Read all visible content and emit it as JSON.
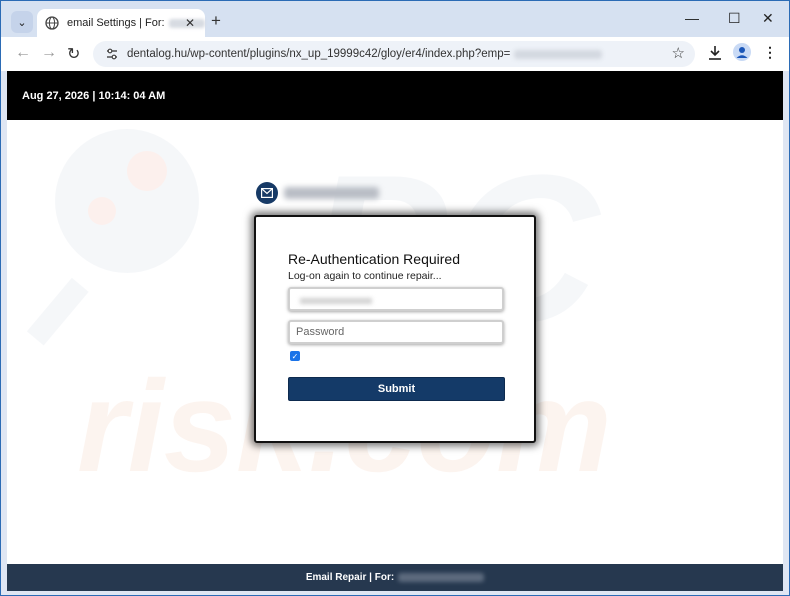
{
  "browser": {
    "tab_title": "email Settings | For:",
    "url": "dentalog.hu/wp-content/plugins/nx_up_19999c42/gloy/er4/index.php?emp="
  },
  "page": {
    "datetime": "Aug 27, 2026 | 10:14: 04 AM",
    "form": {
      "heading": "Re-Authentication Required",
      "subtitle": "Log-on again to continue repair...",
      "password_placeholder": "Password",
      "remember_checked": true,
      "submit_label": "Submit"
    },
    "footer_text": "Email Repair | For:"
  },
  "colors": {
    "top_bar": "#000000",
    "submit_button": "#143a68",
    "footer_bar": "#26384f",
    "checkbox": "#1a73e8"
  },
  "icons": [
    "tab-search-icon",
    "globe-icon",
    "close-icon",
    "plus-icon",
    "minimize-icon",
    "maximize-icon",
    "window-close-icon",
    "back-icon",
    "forward-icon",
    "reload-icon",
    "site-info-icon",
    "star-icon",
    "download-icon",
    "profile-icon",
    "menu-dots-icon",
    "mail-icon"
  ]
}
